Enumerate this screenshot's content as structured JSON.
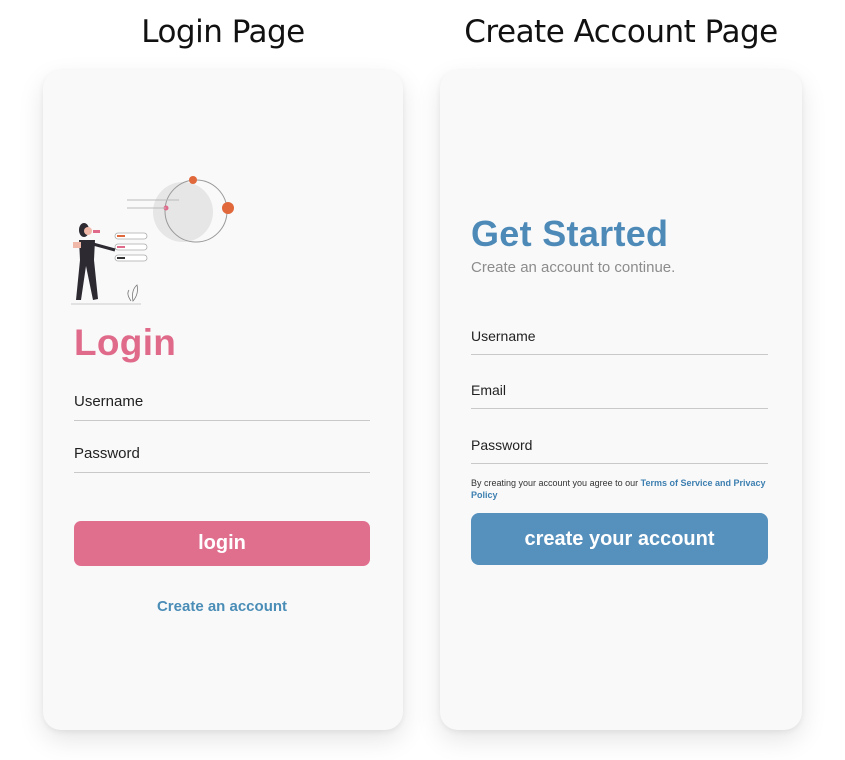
{
  "captions": {
    "login": "Login Page",
    "create": "Create Account Page"
  },
  "login_page": {
    "title": "Login",
    "username_label": "Username",
    "password_label": "Password",
    "login_button": "login",
    "create_link": "Create an account",
    "illustration": "woman-with-checklist-illustration"
  },
  "create_page": {
    "title": "Get Started",
    "subtitle": "Create an account to continue.",
    "username_label": "Username",
    "email_label": "Email",
    "password_label": "Password",
    "terms_prefix": "By creating your account you agree to our ",
    "terms_link": "Terms of Service and Privacy Policy",
    "create_button": "create your account"
  },
  "colors": {
    "login_accent": "#e06a8a",
    "create_accent": "#4d8ab8",
    "link_blue": "#4a8db6",
    "illustration_orange": "#e0683a"
  }
}
